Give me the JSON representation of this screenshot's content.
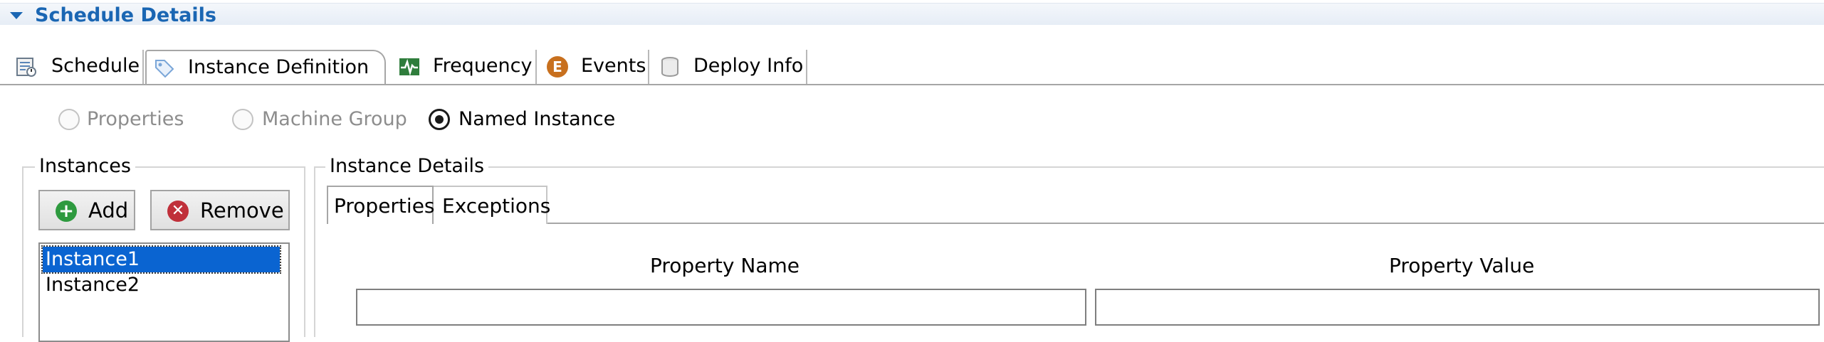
{
  "section": {
    "title": "Schedule Details"
  },
  "tabs": [
    {
      "label": "Schedule",
      "icon": "schedule-icon"
    },
    {
      "label": "Instance Definition",
      "icon": "tag-icon",
      "active": true
    },
    {
      "label": "Frequency",
      "icon": "frequency-icon"
    },
    {
      "label": "Events",
      "icon": "events-icon"
    },
    {
      "label": "Deploy Info",
      "icon": "database-icon"
    }
  ],
  "definition_mode": {
    "options": [
      {
        "label": "Properties",
        "enabled": false,
        "selected": false
      },
      {
        "label": "Machine Group",
        "enabled": false,
        "selected": false
      },
      {
        "label": "Named Instance",
        "enabled": true,
        "selected": true
      }
    ]
  },
  "instances": {
    "title": "Instances",
    "add_label": "Add",
    "remove_label": "Remove",
    "items": [
      "Instance1",
      "Instance2"
    ],
    "selected": "Instance1"
  },
  "details": {
    "title": "Instance Details",
    "tabs": [
      {
        "label": "Properties",
        "active": true
      },
      {
        "label": "Exceptions",
        "active": false
      }
    ],
    "columns": {
      "name": "Property Name",
      "value": "Property Value"
    },
    "name_value": "",
    "value_value": ""
  },
  "colors": {
    "accent": "#1a66b3",
    "selection": "#0a64d1",
    "add_icon": "#2e9a3f",
    "remove_icon": "#c0303a"
  }
}
